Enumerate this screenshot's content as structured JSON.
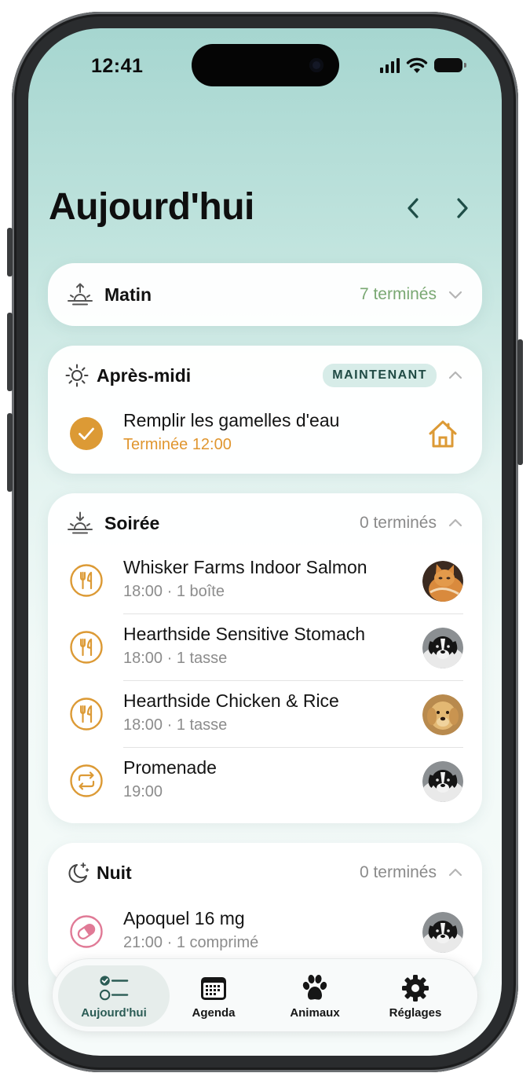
{
  "status": {
    "time": "12:41"
  },
  "header": {
    "title": "Aujourd'hui"
  },
  "sections": {
    "morning": {
      "title": "Matin",
      "count": "7 terminés"
    },
    "afternoon": {
      "title": "Après-midi",
      "badge": "MAINTENANT",
      "tasks": [
        {
          "title": "Remplir les gamelles d'eau",
          "subtitle": "Terminée 12:00",
          "icon": "house-icon"
        }
      ]
    },
    "evening": {
      "title": "Soirée",
      "count": "0 terminés",
      "tasks": [
        {
          "title": "Whisker Farms Indoor Salmon",
          "subtitle": "18:00 · 1 boîte",
          "icon": "fork-knife-icon",
          "avatar": "orange cat"
        },
        {
          "title": "Hearthside Sensitive Stomach",
          "subtitle": "18:00 · 1 tasse",
          "icon": "fork-knife-icon",
          "avatar": "black-white dog"
        },
        {
          "title": "Hearthside Chicken & Rice",
          "subtitle": "18:00 · 1 tasse",
          "icon": "fork-knife-icon",
          "avatar": "golden dog"
        },
        {
          "title": "Promenade",
          "subtitle": "19:00",
          "icon": "repeat-icon",
          "avatar": "black-white dog"
        }
      ]
    },
    "night": {
      "title": "Nuit",
      "count": "0 terminés",
      "tasks": [
        {
          "title": "Apoquel 16 mg",
          "subtitle": "21:00 · 1 comprimé",
          "icon": "pill-icon",
          "avatar": "black-white dog"
        }
      ]
    }
  },
  "tabs": [
    {
      "label": "Aujourd'hui",
      "icon": "checklist-icon",
      "active": true
    },
    {
      "label": "Agenda",
      "icon": "calendar-icon"
    },
    {
      "label": "Animaux",
      "icon": "paw-icon"
    },
    {
      "label": "Réglages",
      "icon": "gear-icon"
    }
  ],
  "colors": {
    "accent_orange": "#dc9a35",
    "accent_green": "#7aa873",
    "teal_dark": "#2b5c55",
    "pill_pink": "#e07a96"
  }
}
